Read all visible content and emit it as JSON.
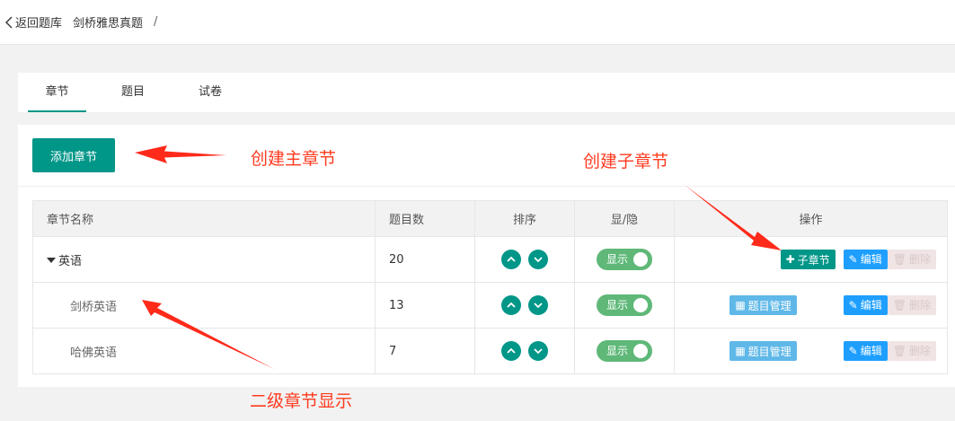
{
  "header": {
    "back_label": "返回题库",
    "crumb": "剑桥雅思真题",
    "separator": "/"
  },
  "tabs": [
    {
      "label": "章节",
      "active": true
    },
    {
      "label": "题目",
      "active": false
    },
    {
      "label": "试卷",
      "active": false
    }
  ],
  "toolbar": {
    "add_chapter_label": "添加章节"
  },
  "table": {
    "columns": [
      "章节名称",
      "题目数",
      "排序",
      "显/隐",
      "操作"
    ],
    "rows": [
      {
        "name": "英语",
        "count": "20",
        "toggle": "显示",
        "level": 1,
        "expanded": true
      },
      {
        "name": "剑桥英语",
        "count": "13",
        "toggle": "显示",
        "level": 2
      },
      {
        "name": "哈佛英语",
        "count": "7",
        "toggle": "显示",
        "level": 2
      }
    ],
    "actions": {
      "sub_chapter": "子章节",
      "edit": "编辑",
      "delete": "删除",
      "question_manage": "题目管理"
    }
  },
  "annotations": {
    "create_main": "创建主章节",
    "create_sub": "创建子章节",
    "second_level": "二级章节显示"
  },
  "colors": {
    "primary": "#009688",
    "toggle": "#5fb878",
    "edit": "#1e9fff",
    "manage": "#5fb8e8",
    "annotation": "#ff3b1f"
  }
}
